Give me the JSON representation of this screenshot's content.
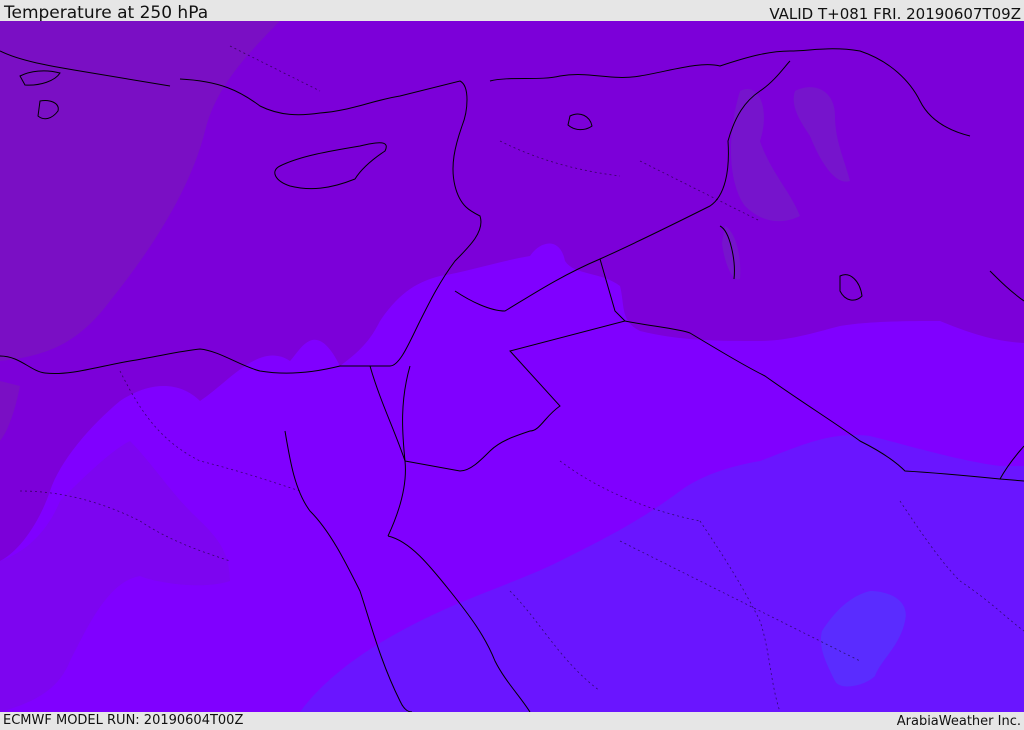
{
  "header": {
    "title": "Temperature at 250 hPa",
    "valid": "VALID T+081 FRI. 20190607T09Z"
  },
  "footer": {
    "model_run": "ECMWF MODEL RUN: 20190604T00Z",
    "credit": "ArabiaWeather Inc."
  },
  "map": {
    "layer": "temperature-250hpa",
    "colors": {
      "band_coldest": "#7a0fc4",
      "band_cold": "#7c00d9",
      "band_mid": "#8000ff",
      "band_warm": "#6a15ff",
      "band_warmest": "#5a2cff",
      "coastline": "#000000",
      "border": "#000000"
    }
  }
}
